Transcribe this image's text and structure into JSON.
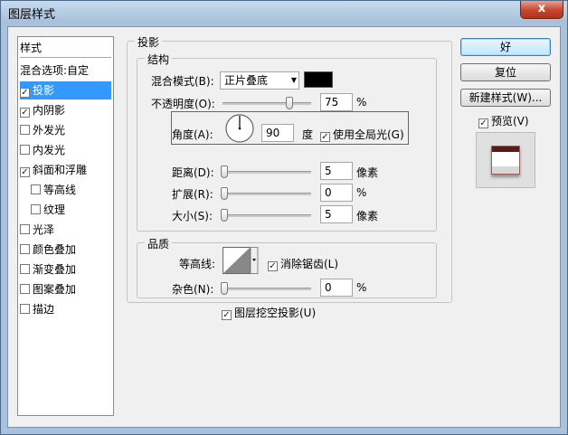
{
  "window": {
    "title": "图层样式",
    "close_label": "x"
  },
  "styles": {
    "header": "样式",
    "blend_options": "混合选项:自定",
    "items": [
      {
        "label": "投影",
        "checked": true,
        "selected": true
      },
      {
        "label": "内阴影",
        "checked": true
      },
      {
        "label": "外发光",
        "checked": false
      },
      {
        "label": "内发光",
        "checked": false
      },
      {
        "label": "斜面和浮雕",
        "checked": true
      },
      {
        "label": "等高线",
        "checked": false,
        "sub": true
      },
      {
        "label": "纹理",
        "checked": false,
        "sub": true
      },
      {
        "label": "光泽",
        "checked": false
      },
      {
        "label": "颜色叠加",
        "checked": false
      },
      {
        "label": "渐变叠加",
        "checked": false
      },
      {
        "label": "图案叠加",
        "checked": false
      },
      {
        "label": "描边",
        "checked": false
      }
    ]
  },
  "drop_shadow": {
    "title": "投影",
    "structure": {
      "title": "结构",
      "blend_mode_label": "混合模式(B):",
      "blend_mode_value": "正片叠底",
      "shadow_color": "#000000",
      "opacity_label": "不透明度(O):",
      "opacity_value": "75",
      "opacity_level": 0.75,
      "percent": "%",
      "angle_label": "角度(A):",
      "angle_value": "90",
      "angle_unit": "度",
      "global_light_label": "使用全局光(G)",
      "global_light_checked": true,
      "distance_label": "距离(D):",
      "distance_value": "5",
      "spread_label": "扩展(R):",
      "spread_value": "0",
      "size_label": "大小(S):",
      "size_value": "5",
      "pixel_unit": "像素"
    },
    "quality": {
      "title": "品质",
      "contour_label": "等高线:",
      "antialias_label": "消除锯齿(L)",
      "antialias_checked": true,
      "noise_label": "杂色(N):",
      "noise_value": "0",
      "percent": "%"
    },
    "knockout_label": "图层挖空投影(U)",
    "knockout_checked": true
  },
  "buttons": {
    "ok": "好",
    "reset": "复位",
    "new_style": "新建样式(W)...",
    "preview_label": "预览(V)",
    "preview_checked": true
  },
  "colors": {
    "accent_selection": "#3399ff",
    "highlight_box": "#d03a32",
    "preview_swatch": "#5a1a1a"
  }
}
